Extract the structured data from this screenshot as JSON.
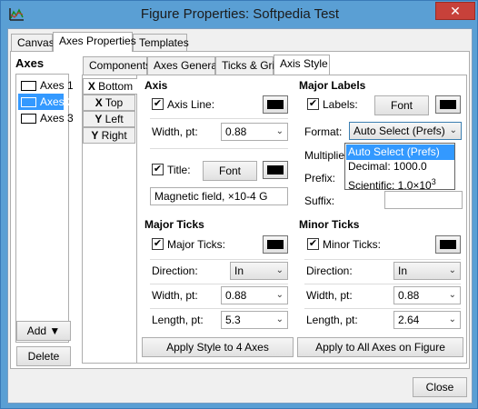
{
  "window": {
    "title": "Figure Properties: Softpedia Test",
    "close_glyph": "✕"
  },
  "main_tabs": [
    {
      "label": "Canvas"
    },
    {
      "label": "Axes Properties"
    },
    {
      "label": "Templates"
    }
  ],
  "axes_list": {
    "heading": "Axes",
    "items": [
      "Axes 1",
      "Axes 2",
      "Axes 3"
    ],
    "selected_index": 1,
    "add_label": "Add ▼",
    "delete_label": "Delete"
  },
  "sub_tabs": [
    {
      "label": "Components"
    },
    {
      "label": "Axes General"
    },
    {
      "label": "Ticks & Grid"
    },
    {
      "label": "Axis Style"
    }
  ],
  "side_tabs": [
    {
      "bold": "X",
      "rest": " Bottom"
    },
    {
      "bold": "X",
      "rest": " Top"
    },
    {
      "bold": "Y",
      "rest": " Left"
    },
    {
      "bold": "Y",
      "rest": " Right"
    }
  ],
  "axis": {
    "heading": "Axis",
    "axis_line_label": "Axis Line:",
    "axis_line_checked": true,
    "width_label": "Width, pt:",
    "width_value": "0.88",
    "title_label": "Title:",
    "title_checked": true,
    "font_label": "Font",
    "title_text": "Magnetic field, ×10-4 G"
  },
  "major_labels": {
    "heading": "Major Labels",
    "labels_label": "Labels:",
    "labels_checked": true,
    "font_label": "Font",
    "format_label": "Format:",
    "format_value": "Auto Select (Prefs)",
    "multiplier_label": "Multiplier:",
    "prefix_label": "Prefix:",
    "suffix_label": "Suffix:",
    "suffix_value": "",
    "format_options": [
      "Auto Select (Prefs)",
      "Decimal: 1000.0",
      "Scientific: 1.0×10"
    ],
    "scientific_exponent": "3"
  },
  "major_ticks": {
    "heading": "Major Ticks",
    "ticks_label": "Major Ticks:",
    "ticks_checked": true,
    "direction_label": "Direction:",
    "direction_value": "In",
    "width_label": "Width, pt:",
    "width_value": "0.88",
    "length_label": "Length, pt:",
    "length_value": "5.3"
  },
  "minor_ticks": {
    "heading": "Minor Ticks",
    "ticks_label": "Minor Ticks:",
    "ticks_checked": true,
    "direction_label": "Direction:",
    "direction_value": "In",
    "width_label": "Width, pt:",
    "width_value": "0.88",
    "length_label": "Length, pt:",
    "length_value": "2.64"
  },
  "actions": {
    "apply_style_label": "Apply Style to 4 Axes",
    "apply_all_label": "Apply to All Axes on Figure",
    "close_label": "Close"
  },
  "colors": {
    "selection": "#3399ff",
    "title_bar": "#5a9fd4",
    "close_button": "#c7413a",
    "swatch": "#000000"
  },
  "icons": {
    "checkbox_mark": "✔",
    "chevron": "⌄"
  }
}
